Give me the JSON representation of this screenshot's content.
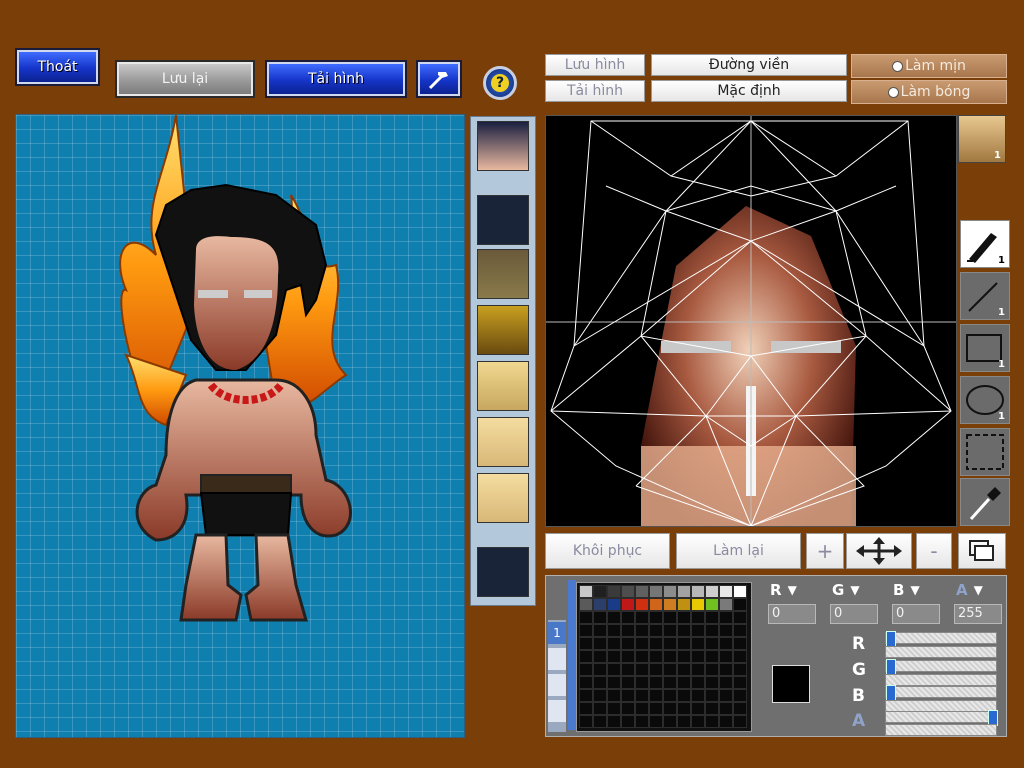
{
  "toolbar": {
    "exit_label": "Thoát",
    "save_label": "Lưu lại",
    "load_label": "Tải hình"
  },
  "editor_top": {
    "save_image_label": "Lưu hình",
    "load_image_label": "Tải hình",
    "outline_label": "Đường viền",
    "default_label": "Mặc định",
    "smooth_label": "Làm mịn",
    "shade_label": "Làm bóng"
  },
  "editor_bottom": {
    "restore_label": "Khôi phục",
    "redo_label": "Làm lại",
    "zoom_in_label": "+",
    "zoom_out_label": "-"
  },
  "tools": [
    {
      "name": "pen-tool",
      "badge": "1"
    },
    {
      "name": "line-tool",
      "badge": "1"
    },
    {
      "name": "rectangle-tool",
      "badge": "1"
    },
    {
      "name": "ellipse-tool",
      "badge": "1"
    },
    {
      "name": "select-tool",
      "badge": ""
    },
    {
      "name": "eyedropper-tool",
      "badge": ""
    }
  ],
  "preview_badge": "1",
  "palette": {
    "colors": [
      "#c8c8c8",
      "#1f1f1f",
      "#3a3a3a",
      "#4d4d4d",
      "#606060",
      "#767676",
      "#8c8c8c",
      "#a2a2a2",
      "#b8b8b8",
      "#cecece",
      "#e8e8e8",
      "#ffffff",
      "#5a5a5a",
      "#2c3e6a",
      "#1a3c88",
      "#c01818",
      "#d03010",
      "#d06418",
      "#d07c20",
      "#c09010",
      "#e8c800",
      "#70c020",
      "#7a7a7a"
    ],
    "page_tab": "1"
  },
  "color": {
    "r_label": "R",
    "g_label": "G",
    "b_label": "B",
    "a_label": "A",
    "r": "0",
    "g": "0",
    "b": "0",
    "a": "255",
    "current_color": "#000000"
  }
}
